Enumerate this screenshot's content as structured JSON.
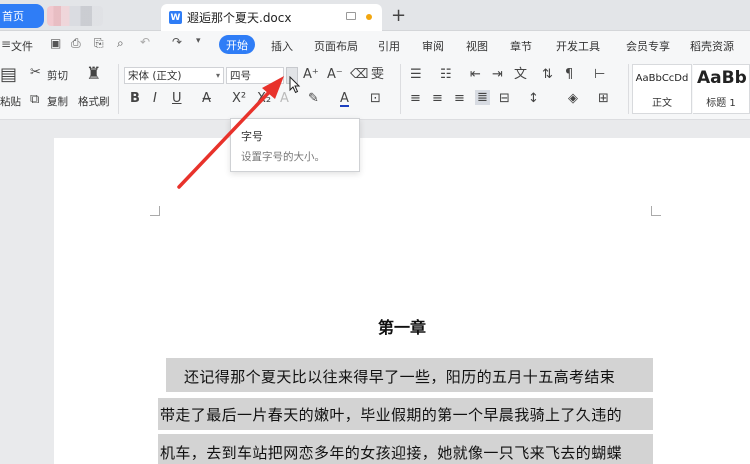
{
  "tabs": {
    "home": "首页",
    "document_title": "遐逅那个夏天.docx",
    "doc_icon_letter": "W",
    "new_tab": "+"
  },
  "menu": {
    "file": "文件",
    "start": "开始",
    "items": [
      "插入",
      "页面布局",
      "引用",
      "审阅",
      "视图",
      "章节",
      "开发工具",
      "会员专享",
      "稻壳资源"
    ]
  },
  "ribbon": {
    "paste": "粘贴",
    "cut": "剪切",
    "copy": "复制",
    "format_painter": "格式刷",
    "font_name": "宋体 (正文)",
    "font_size": "四号",
    "style_normal_sample": "AaBbCcDd",
    "style_normal_name": "正文",
    "style_heading_sample": "AaBb",
    "style_heading_name": "标题 1"
  },
  "tooltip": {
    "title": "字号",
    "description": "设置字号的大小。"
  },
  "document": {
    "chapter_title": "第一章",
    "lines": [
      "还记得那个夏天比以往来得早了一些，阳历的五月十五高考结束",
      "带走了最后一片春天的嫩叶，毕业假期的第一个早晨我骑上了久违的",
      "机车，去到车站把网恋多年的女孩迎接，她就像一只飞来飞去的蝴蝶"
    ]
  },
  "colors": {
    "accent": "#2f7df6",
    "annotation_arrow": "#e8322b",
    "selection_highlight": "#d3d3d3"
  }
}
